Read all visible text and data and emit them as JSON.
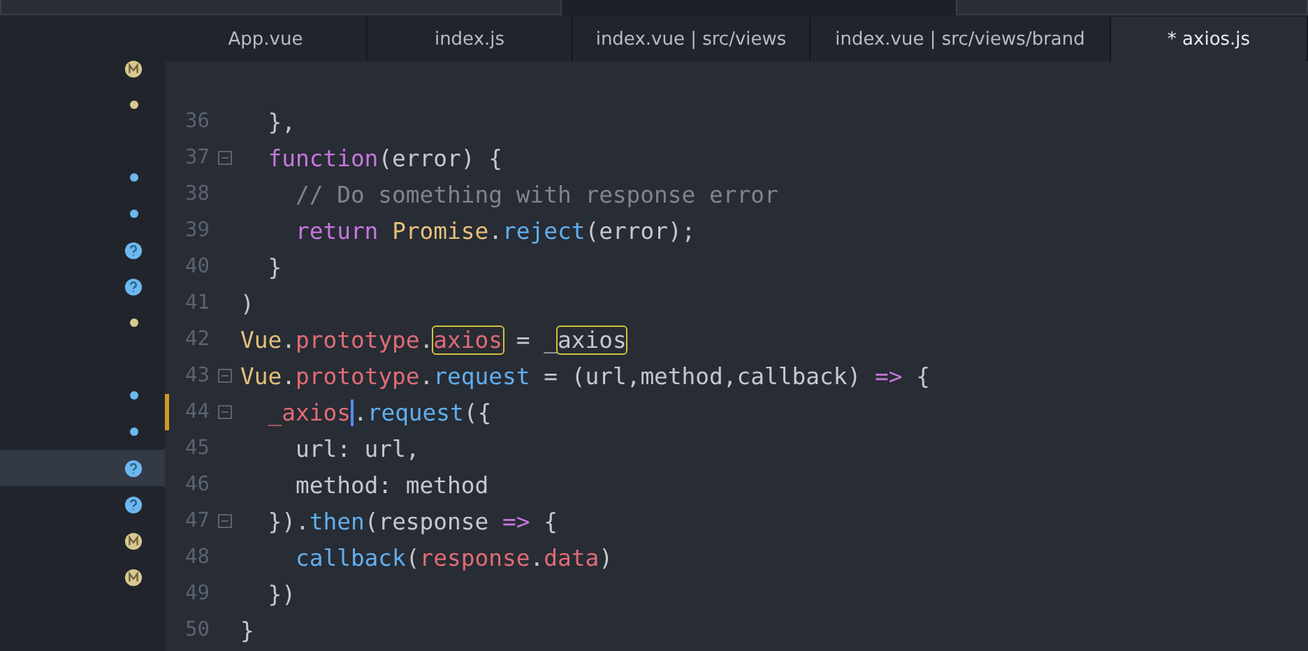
{
  "tabs": [
    {
      "label": "App.vue",
      "selected": false
    },
    {
      "label": "index.js",
      "selected": false
    },
    {
      "label": "index.vue | src/views",
      "selected": false
    },
    {
      "label": "index.vue | src/views/brand",
      "selected": false
    },
    {
      "label": "* axios.js",
      "selected": true
    }
  ],
  "sidebar": {
    "items": [
      {
        "kind": "modified",
        "selected": false
      },
      {
        "kind": "dot-modified",
        "selected": false
      },
      {
        "kind": "none",
        "selected": false
      },
      {
        "kind": "dot-untracked",
        "selected": false
      },
      {
        "kind": "dot-untracked",
        "selected": false
      },
      {
        "kind": "untracked",
        "selected": false
      },
      {
        "kind": "untracked",
        "selected": false
      },
      {
        "kind": "dot-modified",
        "selected": false
      },
      {
        "kind": "none",
        "selected": false
      },
      {
        "kind": "dot-untracked",
        "selected": false
      },
      {
        "kind": "dot-untracked",
        "selected": false
      },
      {
        "kind": "untracked",
        "selected": true
      },
      {
        "kind": "untracked",
        "selected": false
      },
      {
        "kind": "modified",
        "selected": false
      },
      {
        "kind": "modified",
        "selected": false
      }
    ]
  },
  "editor": {
    "lines": [
      {
        "number": "36",
        "foldable": false,
        "modified": false,
        "tokens": [
          {
            "text": "  },",
            "kind": "plain"
          }
        ]
      },
      {
        "number": "37",
        "foldable": true,
        "modified": false,
        "tokens": [
          {
            "text": "  function",
            "kind": "keyword"
          },
          {
            "text": "(error) {",
            "kind": "plain"
          }
        ]
      },
      {
        "number": "38",
        "foldable": false,
        "modified": false,
        "tokens": [
          {
            "text": "    // Do something with response error",
            "kind": "comment"
          }
        ]
      },
      {
        "number": "39",
        "foldable": false,
        "modified": false,
        "tokens": [
          {
            "text": "    return ",
            "kind": "keyword"
          },
          {
            "text": "Promise",
            "kind": "class"
          },
          {
            "text": ".",
            "kind": "plain"
          },
          {
            "text": "reject",
            "kind": "method"
          },
          {
            "text": "(error);",
            "kind": "plain"
          }
        ]
      },
      {
        "number": "40",
        "foldable": false,
        "modified": false,
        "tokens": [
          {
            "text": "  }",
            "kind": "plain"
          }
        ]
      },
      {
        "number": "41",
        "foldable": false,
        "modified": false,
        "tokens": [
          {
            "text": ")",
            "kind": "plain"
          }
        ]
      },
      {
        "number": "42",
        "foldable": false,
        "modified": false,
        "tokens": [
          {
            "text": "Vue",
            "kind": "class"
          },
          {
            "text": ".",
            "kind": "plain"
          },
          {
            "text": "prototype",
            "kind": "property"
          },
          {
            "text": ".",
            "kind": "plain"
          },
          {
            "text": "axios",
            "kind": "property",
            "highlighted": true
          },
          {
            "text": " = _",
            "kind": "plain"
          },
          {
            "text": "axios",
            "kind": "plain",
            "highlighted": true
          }
        ]
      },
      {
        "number": "43",
        "foldable": true,
        "modified": false,
        "tokens": [
          {
            "text": "Vue",
            "kind": "class"
          },
          {
            "text": ".",
            "kind": "plain"
          },
          {
            "text": "prototype",
            "kind": "property"
          },
          {
            "text": ".",
            "kind": "plain"
          },
          {
            "text": "request",
            "kind": "method"
          },
          {
            "text": " = (url,method,callback) ",
            "kind": "plain"
          },
          {
            "text": "=>",
            "kind": "keyword"
          },
          {
            "text": " {",
            "kind": "plain"
          }
        ]
      },
      {
        "number": "44",
        "foldable": true,
        "modified": true,
        "tokens": [
          {
            "text": "  _axios",
            "kind": "property",
            "cursor": true
          },
          {
            "text": ".",
            "kind": "plain"
          },
          {
            "text": "request",
            "kind": "method"
          },
          {
            "text": "({",
            "kind": "plain"
          }
        ]
      },
      {
        "number": "45",
        "foldable": false,
        "modified": false,
        "tokens": [
          {
            "text": "    url: url,",
            "kind": "plain"
          }
        ]
      },
      {
        "number": "46",
        "foldable": false,
        "modified": false,
        "tokens": [
          {
            "text": "    method: method",
            "kind": "plain"
          }
        ]
      },
      {
        "number": "47",
        "foldable": true,
        "modified": false,
        "tokens": [
          {
            "text": "  }).",
            "kind": "plain"
          },
          {
            "text": "then",
            "kind": "method"
          },
          {
            "text": "(response ",
            "kind": "plain"
          },
          {
            "text": "=>",
            "kind": "keyword"
          },
          {
            "text": " {",
            "kind": "plain"
          }
        ]
      },
      {
        "number": "48",
        "foldable": false,
        "modified": false,
        "tokens": [
          {
            "text": "    callback",
            "kind": "method"
          },
          {
            "text": "(",
            "kind": "plain"
          },
          {
            "text": "response",
            "kind": "property"
          },
          {
            "text": ".",
            "kind": "plain"
          },
          {
            "text": "data",
            "kind": "property"
          },
          {
            "text": ")",
            "kind": "plain"
          }
        ]
      },
      {
        "number": "49",
        "foldable": false,
        "modified": false,
        "tokens": [
          {
            "text": "  })",
            "kind": "plain"
          }
        ]
      },
      {
        "number": "50",
        "foldable": false,
        "modified": false,
        "tokens": [
          {
            "text": "}",
            "kind": "plain"
          }
        ]
      }
    ]
  }
}
